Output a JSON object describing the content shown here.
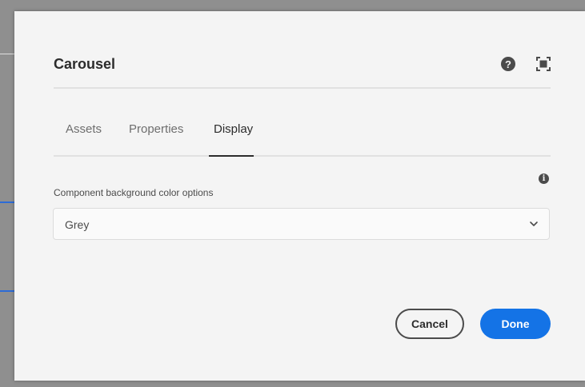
{
  "dialog": {
    "title": "Carousel",
    "help_icon_glyph": "?",
    "fullscreen_icon": "fullscreen-icon"
  },
  "tabs": [
    {
      "label": "Assets",
      "active": false
    },
    {
      "label": "Properties",
      "active": false
    },
    {
      "label": "Display",
      "active": true
    }
  ],
  "display": {
    "info_glyph": "i",
    "field_label": "Component background color options",
    "selected_value": "Grey"
  },
  "footer": {
    "cancel_label": "Cancel",
    "done_label": "Done"
  },
  "colors": {
    "accent": "#1473e6",
    "dialog_bg": "#f4f4f4",
    "backdrop": "#8f8f8f"
  }
}
